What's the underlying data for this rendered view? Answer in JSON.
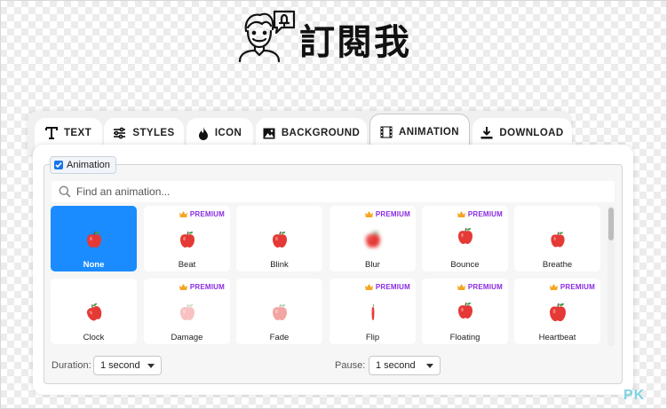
{
  "logo": {
    "text": "訂閱我"
  },
  "tabs": [
    {
      "id": "text",
      "label": "TEXT",
      "icon": "text-icon"
    },
    {
      "id": "styles",
      "label": "STYLES",
      "icon": "sliders-icon"
    },
    {
      "id": "icon",
      "label": "ICON",
      "icon": "flame-icon"
    },
    {
      "id": "background",
      "label": "BACKGROUND",
      "icon": "image-icon"
    },
    {
      "id": "animation",
      "label": "ANIMATION",
      "icon": "film-icon",
      "active": true
    },
    {
      "id": "download",
      "label": "DOWNLOAD",
      "icon": "download-icon"
    }
  ],
  "animation": {
    "toggle_label": "Animation",
    "enabled": true,
    "search_placeholder": "Find an animation...",
    "premium_badge": "PREMIUM",
    "items": [
      {
        "label": "None",
        "premium": false,
        "selected": true
      },
      {
        "label": "Beat",
        "premium": true
      },
      {
        "label": "Blink",
        "premium": false
      },
      {
        "label": "Blur",
        "premium": true
      },
      {
        "label": "Bounce",
        "premium": true
      },
      {
        "label": "Breathe",
        "premium": false
      },
      {
        "label": "Clock",
        "premium": false
      },
      {
        "label": "Damage",
        "premium": true
      },
      {
        "label": "Fade",
        "premium": false
      },
      {
        "label": "Flip",
        "premium": true
      },
      {
        "label": "Floating",
        "premium": true
      },
      {
        "label": "Heartbeat",
        "premium": true
      }
    ],
    "duration": {
      "label": "Duration:",
      "value": "1 second"
    },
    "pause": {
      "label": "Pause:",
      "value": "1 second"
    }
  },
  "watermark": "PK",
  "colors": {
    "accent": "#1a8cff",
    "premium": "#8a2be2",
    "crown": "#f5a623",
    "apple": "#e53935"
  }
}
